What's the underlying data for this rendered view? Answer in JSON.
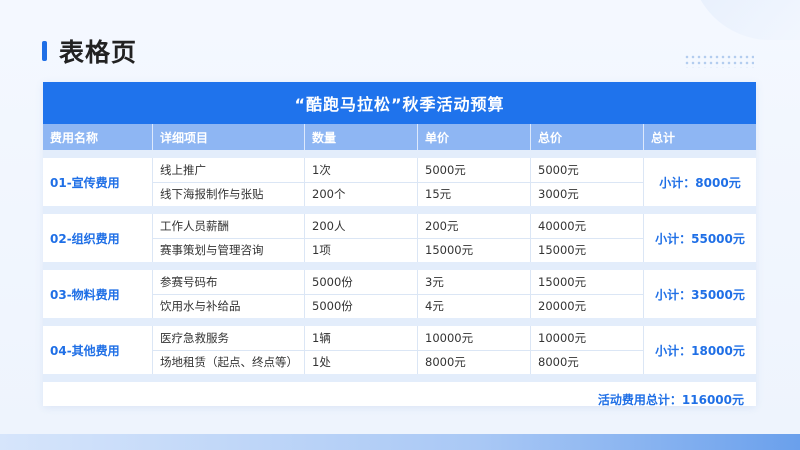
{
  "page": {
    "title": "表格页"
  },
  "table": {
    "title": "“酷跑马拉松”秋季活动预算",
    "headers": [
      "费用名称",
      "详细项目",
      "数量",
      "单价",
      "总价",
      "总计"
    ],
    "groups": [
      {
        "name": "01-宣传费用",
        "subtotal": "小计：8000元",
        "items": [
          {
            "item": "线上推广",
            "qty": "1次",
            "unit": "5000元",
            "total": "5000元"
          },
          {
            "item": "线下海报制作与张贴",
            "qty": "200个",
            "unit": "15元",
            "total": "3000元"
          }
        ]
      },
      {
        "name": "02-组织费用",
        "subtotal": "小计：55000元",
        "items": [
          {
            "item": "工作人员薪酬",
            "qty": "200人",
            "unit": "200元",
            "total": "40000元"
          },
          {
            "item": "赛事策划与管理咨询",
            "qty": "1项",
            "unit": "15000元",
            "total": "15000元"
          }
        ]
      },
      {
        "name": "03-物料费用",
        "subtotal": "小计：35000元",
        "items": [
          {
            "item": "参赛号码布",
            "qty": "5000份",
            "unit": "3元",
            "total": "15000元"
          },
          {
            "item": "饮用水与补给品",
            "qty": "5000份",
            "unit": "4元",
            "total": "20000元"
          }
        ]
      },
      {
        "name": "04-其他费用",
        "subtotal": "小计：18000元",
        "items": [
          {
            "item": "医疗急救服务",
            "qty": "1辆",
            "unit": "10000元",
            "total": "10000元"
          },
          {
            "item": "场地租赁（起点、终点等）",
            "qty": "1处",
            "unit": "8000元",
            "total": "8000元"
          }
        ]
      }
    ],
    "grand_total": "活动费用总计：116000元"
  },
  "colors": {
    "accent": "#1f73ec",
    "header": "#8eb6f3",
    "gap": "#e3edfb"
  }
}
